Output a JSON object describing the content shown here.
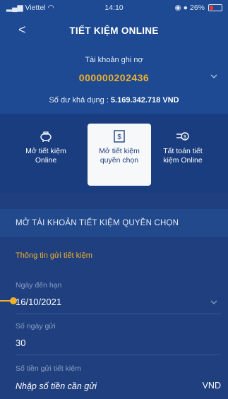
{
  "status": {
    "carrier": "Viettel",
    "time": "14:10",
    "battery": "26%"
  },
  "nav": {
    "back": "<",
    "title": "TIẾT KIỆM ONLINE"
  },
  "account": {
    "label": "Tài khoản ghi nợ",
    "number": "000000202436",
    "balance_prefix": "Số dư khả dụng : ",
    "balance_value": "5.169.342.718 VND"
  },
  "actions": [
    {
      "line1": "Mở tiết kiệm",
      "line2": "Online",
      "icon": "piggy-bank-icon"
    },
    {
      "line1": "Mở tiết kiệm",
      "line2": "quyền chọn",
      "icon": "money-receipt-icon"
    },
    {
      "line1": "Tất toán tiết",
      "line2": "kiệm Online",
      "icon": "coin-transfer-icon"
    }
  ],
  "section": {
    "title": "MỞ TÀI KHOẢN TIẾT KIỆM QUYỀN CHỌN"
  },
  "form": {
    "subhead": "Thông tin gửi tiết kiệm",
    "due_date_label": "Ngày đến hạn",
    "due_date_value": "16/10/2021",
    "days_label": "Số ngày gửi",
    "days_value": "30",
    "amount_label": "Số tiền gửi tiết kiệm",
    "amount_placeholder": "Nhập số tiền cần gửi",
    "amount_unit": "VND"
  },
  "colors": {
    "accent": "#f1b02b",
    "header": "#1d4a92",
    "background": "#1f3f7e"
  }
}
